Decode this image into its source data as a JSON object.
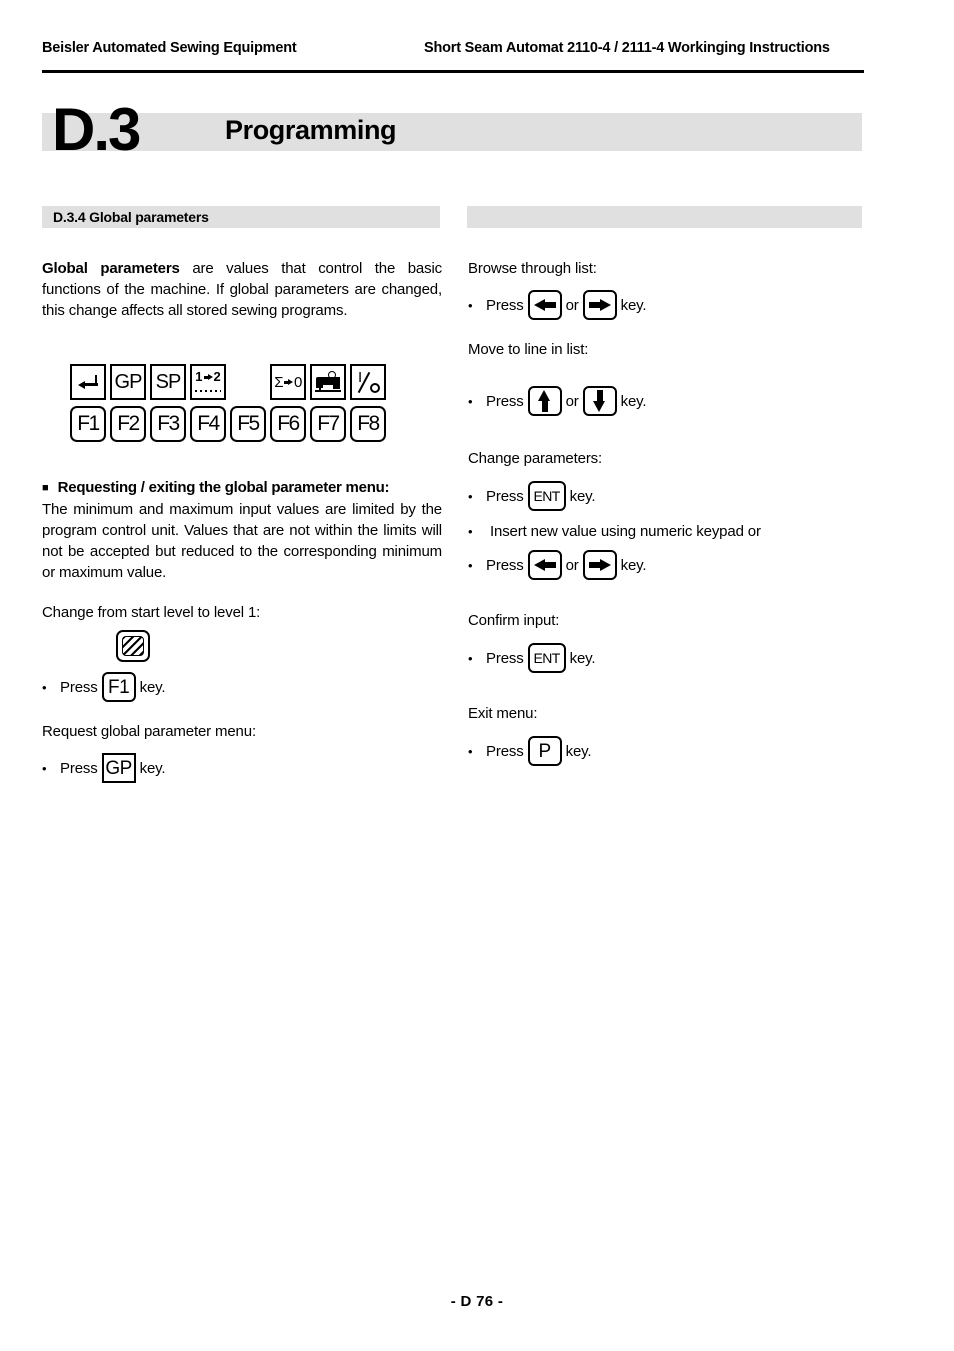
{
  "header": {
    "left": "Beisler Automated Sewing Equipment",
    "right": "Short Seam Automat 2110-4 / 2111-4 Workinging Instructions"
  },
  "title": {
    "chapter_number": "D.3",
    "chapter_name": "Programming",
    "band_color": "#e0e0e0"
  },
  "sections": {
    "left_band_label": "D.3.4 Global parameters",
    "right_band_label": ""
  },
  "left_column": {
    "intro_bold": "Global parameters",
    "intro_rest": " are values that control the basic functions of the machine. If global parameters are changed, this change affects all stored sewing programs.",
    "keypad": {
      "top_row": [
        {
          "icon": "enter-return-icon",
          "label": "",
          "shape": "square"
        },
        {
          "icon": "",
          "label": "GP",
          "shape": "square"
        },
        {
          "icon": "",
          "label": "SP",
          "shape": "square"
        },
        {
          "icon": "one-to-two-icon",
          "label": "1→2",
          "shape": "square"
        },
        {
          "icon": "",
          "label": "",
          "shape": "blank"
        },
        {
          "icon": "sum-to-zero-icon",
          "label": "Σ→0",
          "shape": "square"
        },
        {
          "icon": "sewing-machine-icon",
          "label": "",
          "shape": "square"
        },
        {
          "icon": "io-power-icon",
          "label": "I/O",
          "shape": "square"
        }
      ],
      "bottom_row": [
        "F1",
        "F2",
        "F3",
        "F4",
        "F5",
        "F6",
        "F7",
        "F8"
      ]
    },
    "heading_bullet": "■",
    "heading": "Requesting / exiting the global parameter menu:",
    "paragraph": "The minimum and maximum input values are limited by the program control unit. Values that are not within the limits will not be accepted but reduced to the corresponding minimum or maximum value.",
    "steps": [
      {
        "label": "Change from start level to level 1:",
        "icon_above": "hatched-key-icon",
        "bullet_prefix": "Press",
        "key": "F1",
        "bullet_suffix": "key.",
        "key_shape": "rounded"
      },
      {
        "label": "Request global parameter menu:",
        "icon_above": "",
        "bullet_prefix": "Press",
        "key": "GP",
        "bullet_suffix": "key.",
        "key_shape": "square"
      }
    ]
  },
  "right_column": {
    "groups": [
      {
        "label": "Browse through list:",
        "bullets": [
          {
            "type": "two-keys",
            "prefix": "Press",
            "key1": "arrow-left-icon",
            "joiner": "or",
            "key2": "arrow-right-icon",
            "suffix": "key."
          }
        ]
      },
      {
        "label": "Move to line in list:",
        "bullets": [
          {
            "type": "two-keys",
            "prefix": "Press",
            "key1": "arrow-up-icon",
            "joiner": "or",
            "key2": "arrow-down-icon",
            "suffix": "key."
          }
        ]
      },
      {
        "label": "Change parameters:",
        "bullets": [
          {
            "type": "one-key",
            "prefix": "Press",
            "key1": "ENT",
            "suffix": "key."
          },
          {
            "type": "text",
            "text": "Insert new value using numeric keypad or"
          },
          {
            "type": "two-keys",
            "prefix": "Press",
            "key1": "arrow-left-icon",
            "joiner": "or",
            "key2": "arrow-right-icon",
            "suffix": "key."
          }
        ]
      },
      {
        "label": "Confirm input:",
        "bullets": [
          {
            "type": "one-key",
            "prefix": "Press",
            "key1": "ENT",
            "suffix": "key."
          }
        ]
      },
      {
        "label": "Exit menu:",
        "bullets": [
          {
            "type": "one-key",
            "prefix": "Press",
            "key1": "P",
            "suffix": "key."
          }
        ]
      }
    ]
  },
  "footer": {
    "page_label": "- D 76 -"
  }
}
